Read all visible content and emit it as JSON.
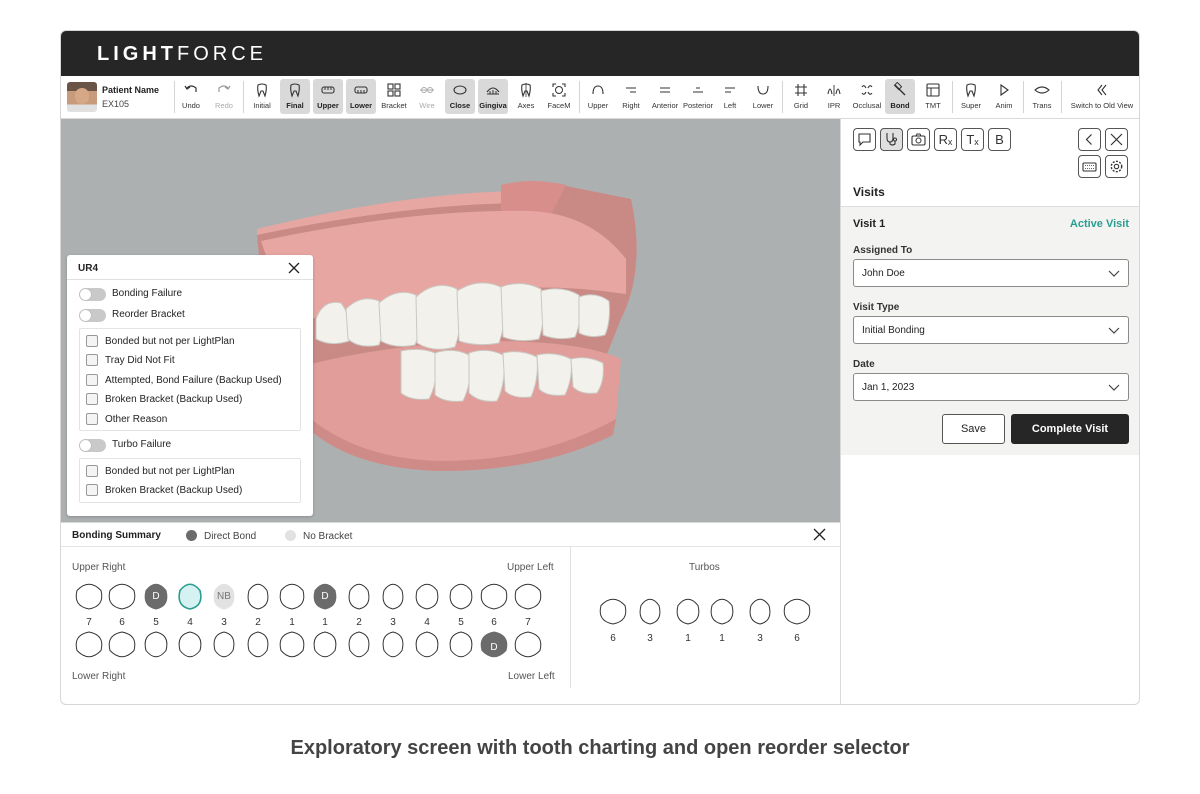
{
  "brand": {
    "logo_bold": "LIGHT",
    "logo_thin": "FORCE"
  },
  "patient": {
    "name": "Patient Name",
    "id": "EX105"
  },
  "toolbar": {
    "undo": "Undo",
    "redo": "Redo",
    "initial": "Initial",
    "final": "Final",
    "upper": "Upper",
    "lower": "Lower",
    "bracket": "Bracket",
    "wire": "Wire",
    "close": "Close",
    "gingiva": "Gingiva",
    "axes": "Axes",
    "facem": "FaceM",
    "view_upper": "Upper",
    "view_right": "Right",
    "view_anterior": "Anterior",
    "view_posterior": "Posterior",
    "view_left": "Left",
    "view_lower": "Lower",
    "grid": "Grid",
    "ipr": "IPR",
    "occlusal": "Occlusal",
    "bond": "Bond",
    "tmt": "TMT",
    "super": "Super",
    "anim": "Anim",
    "trans": "Trans",
    "switch_old": "Switch to Old View"
  },
  "reorder_popup": {
    "title": "UR4",
    "bonding_failure": "Bonding Failure",
    "reorder_bracket": "Reorder Bracket",
    "reorder_reasons": [
      "Bonded but not per LightPlan",
      "Tray Did Not Fit",
      "Attempted, Bond Failure (Backup Used)",
      "Broken Bracket (Backup Used)",
      "Other Reason"
    ],
    "turbo_failure": "Turbo Failure",
    "turbo_reasons": [
      "Bonded but not per LightPlan",
      "Broken Bracket (Backup Used)"
    ]
  },
  "bonding_summary": {
    "title": "Bonding Summary",
    "legend_direct": "Direct Bond",
    "legend_none": "No Bracket",
    "upper_right": "Upper Right",
    "upper_left": "Upper Left",
    "lower_right": "Lower Right",
    "lower_left": "Lower Left",
    "tooth_numbers": [
      "7",
      "6",
      "5",
      "4",
      "3",
      "2",
      "1",
      "1",
      "2",
      "3",
      "4",
      "5",
      "6",
      "7"
    ],
    "direct_mark": "D",
    "no_bracket_mark": "NB",
    "turbos_title": "Turbos",
    "turbo_numbers": [
      "6",
      "3",
      "1",
      "1",
      "3",
      "6"
    ]
  },
  "colors": {
    "accent": "#2a9d92",
    "direct": "#6b6b6b",
    "no_bracket": "#e2e2e2",
    "selected": "#d5f1f1"
  },
  "sidebar": {
    "rx_glyph": "Rₓ",
    "tx_glyph": "Tₓ",
    "b_glyph": "B",
    "visits_title": "Visits",
    "visit_name": "Visit 1",
    "visit_status": "Active Visit",
    "assigned_label": "Assigned To",
    "assigned_value": "John Doe",
    "type_label": "Visit Type",
    "type_value": "Initial Bonding",
    "date_label": "Date",
    "date_value": "Jan 1, 2023",
    "save": "Save",
    "complete": "Complete Visit"
  },
  "caption": "Exploratory screen with tooth charting and open reorder selector"
}
